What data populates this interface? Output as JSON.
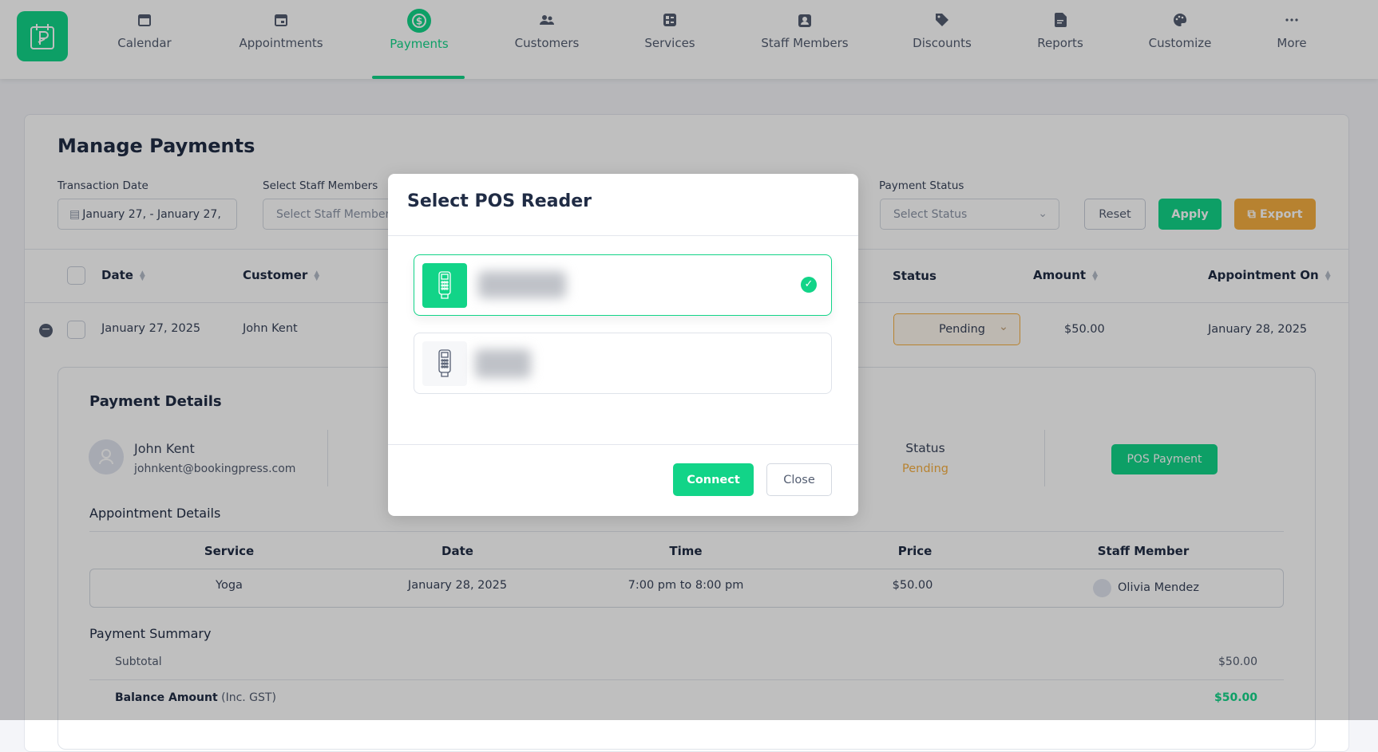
{
  "colors": {
    "accent": "#12d488",
    "warning": "#f5ae41"
  },
  "nav": {
    "items": [
      {
        "label": "Calendar",
        "icon": "calendar-icon"
      },
      {
        "label": "Appointments",
        "icon": "appointment-icon"
      },
      {
        "label": "Payments",
        "icon": "dollar-icon",
        "active": true
      },
      {
        "label": "Customers",
        "icon": "users-icon"
      },
      {
        "label": "Services",
        "icon": "services-icon"
      },
      {
        "label": "Staff Members",
        "icon": "staff-badge-icon"
      },
      {
        "label": "Discounts",
        "icon": "tag-icon"
      },
      {
        "label": "Reports",
        "icon": "report-icon"
      },
      {
        "label": "Customize",
        "icon": "palette-icon"
      },
      {
        "label": "More",
        "icon": "more-dots-icon"
      }
    ]
  },
  "page": {
    "title": "Manage Payments"
  },
  "filters": {
    "date_label": "Transaction Date",
    "date_value": "January 27,  -  January 27,",
    "staff_label": "Select Staff Members",
    "staff_placeholder": "Select Staff Members",
    "status_label": "Payment Status",
    "status_placeholder": "Select Status",
    "reset": "Reset",
    "apply": "Apply",
    "export": "Export"
  },
  "table": {
    "headers": {
      "date": "Date",
      "customer": "Customer",
      "status": "Status",
      "amount": "Amount",
      "appointment_on": "Appointment On"
    },
    "rows": [
      {
        "date": "January 27, 2025",
        "customer": "John Kent",
        "status": "Pending",
        "amount": "$50.00",
        "appointment_on": "January 28, 2025"
      }
    ]
  },
  "details": {
    "title": "Payment Details",
    "customer_name": "John Kent",
    "customer_email": "johnkent@bookingpress.com",
    "status_label": "Status",
    "status_value": "Pending",
    "pos_button": "POS Payment",
    "appointment_title": "Appointment Details",
    "appt_headers": {
      "service": "Service",
      "date": "Date",
      "time": "Time",
      "price": "Price",
      "staff": "Staff Member"
    },
    "appt_row": {
      "service": "Yoga",
      "date": "January 28, 2025",
      "time": "7:00 pm to 8:00 pm",
      "price": "$50.00",
      "staff": "Olivia Mendez"
    },
    "summary_title": "Payment Summary",
    "subtotal_label": "Subtotal",
    "subtotal_value": "$50.00",
    "balance_label": "Balance Amount",
    "balance_note": "(Inc. GST)",
    "balance_value": "$50.00"
  },
  "modal": {
    "title": "Select POS Reader",
    "readers": [
      {
        "selected": true
      },
      {
        "selected": false
      }
    ],
    "connect": "Connect",
    "close": "Close"
  }
}
